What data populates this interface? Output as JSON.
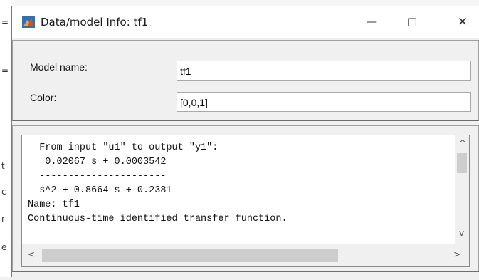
{
  "background": {
    "marks": [
      "=",
      "=",
      "t",
      "c",
      "r",
      "e"
    ]
  },
  "window": {
    "title": "Data/model Info: tf1",
    "controls": {
      "minimize": "—",
      "maximize": "☐",
      "close": "✕"
    }
  },
  "model_name": {
    "label": "Model name:",
    "value": "tf1"
  },
  "color": {
    "label": "Color:",
    "value": "[0,0,1]"
  },
  "info_text": {
    "lines": [
      "  From input \"u1\" to output \"y1\":",
      "   0.02067 s + 0.0003542",
      "  ----------------------",
      "  s^2 + 0.8664 s + 0.2381",
      "Name: tf1",
      "Continuous-time identified transfer function."
    ]
  },
  "scrollbars": {
    "up": "^",
    "down": "v",
    "left": "<",
    "right": ">"
  },
  "colors": {
    "titlebar": "#ffffff",
    "window_bg": "#f0f0f0",
    "matlab_icon": "#d9531e"
  }
}
